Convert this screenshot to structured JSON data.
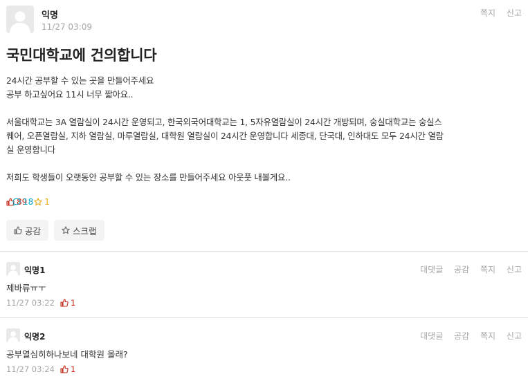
{
  "post": {
    "author": "익명",
    "time": "11/27 03:09",
    "actions": {
      "message": "쪽지",
      "report": "신고"
    },
    "title": "국민대학교에 건의합니다",
    "body": {
      "line1": "24시간 공부할 수 있는 곳을 만들어주세요",
      "line2": "공부 하고싶어요 11시 너무 짧아요..",
      "line3": "서울대학교는 3A 열람실이 24시간 운영되고, 한국외국어대학교는 1, 5자유열람실이 24시간 개방되며, 숭실대학교는 숭실스",
      "line4": "퀘어, 오픈열람실, 지하 열람실, 마루열람실, 대학원 열람실이 24시간 운영합니다 세종대, 단국대, 인하대도 모두 24시간 열람",
      "line5": "실 운영합니다",
      "line6": "저희도 학생들이 오랫동안 공부할 수 있는 장소를 만들어주세요 아웃풋 내볼게요.."
    },
    "stats": {
      "likes": "89",
      "comments": "18",
      "scraps": "1"
    },
    "buttons": {
      "like": "공감",
      "scrap": "스크랩"
    }
  },
  "comments": [
    {
      "author": "익명1",
      "text": "제바류ㅠㅜ",
      "time": "11/27 03:22",
      "likes": "1",
      "actions": {
        "reply": "대댓글",
        "like": "공감",
        "message": "쪽지",
        "report": "신고"
      }
    },
    {
      "author": "익명2",
      "text": "공부열심히하나보네 대학원 올래?",
      "time": "11/27 03:24",
      "likes": "1",
      "actions": {
        "reply": "대댓글",
        "like": "공감",
        "message": "쪽지",
        "report": "신고"
      }
    }
  ],
  "colors": {
    "like": "#c62917",
    "comment": "#07a6c7",
    "scrap": "#e7a819",
    "muted": "#a6a6a6"
  }
}
